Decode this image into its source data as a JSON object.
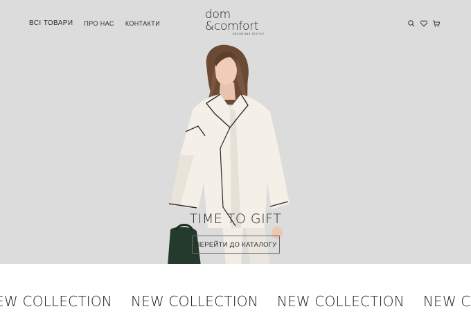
{
  "header": {
    "nav": [
      {
        "label": "ВСІ ТОВАРИ"
      },
      {
        "label": "ПРО НАС"
      },
      {
        "label": "КОНТАКТИ"
      }
    ],
    "logo": {
      "line1": "dom",
      "line2": "&comfort",
      "tagline": "DECOR AND TEXTILE"
    },
    "icons": [
      "search-icon",
      "heart-icon",
      "cart-icon"
    ]
  },
  "hero": {
    "title": "TIME TO GIFT",
    "button_label": "ПЕРЕЙТИ ДО КАТАЛОГУ",
    "background": "#dcdcdc"
  },
  "marquee": {
    "items": [
      "NEW COLLECTION",
      "NEW COLLECTION",
      "NEW COLLECTION",
      "NEW COLLECTION"
    ]
  }
}
